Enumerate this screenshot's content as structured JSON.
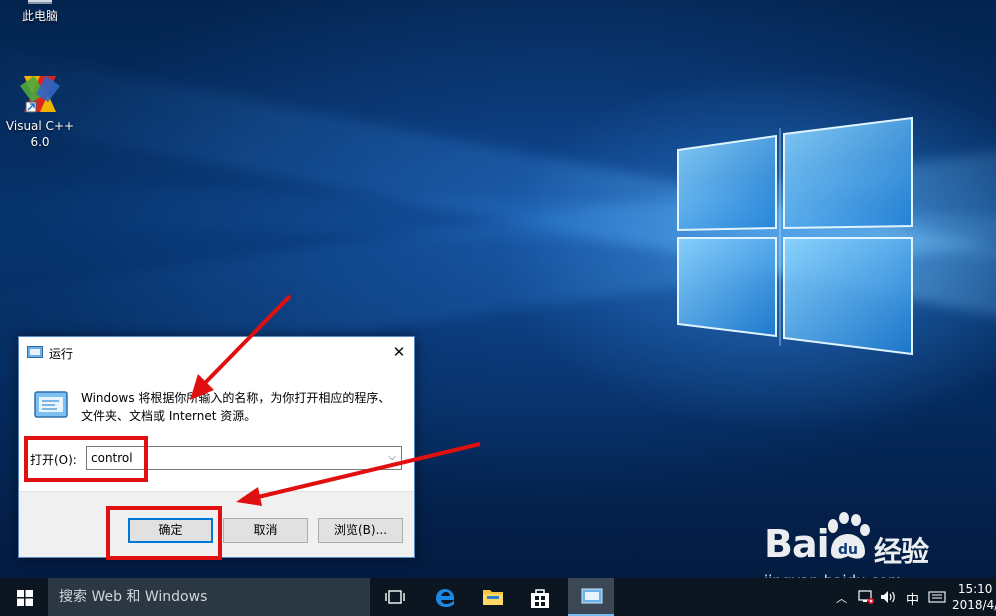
{
  "desktop": {
    "icons": [
      {
        "label": "此电脑",
        "icon": "this-pc-icon"
      },
      {
        "label": "Visual C++ 6.0",
        "icon": "visual-cpp-icon"
      }
    ]
  },
  "run_dialog": {
    "title": "运行",
    "close_glyph": "✕",
    "description": "Windows 将根据你所输入的名称，为你打开相应的程序、文件夹、文档或 Internet 资源。",
    "open_label": "打开(O):",
    "open_value": "control",
    "ok_label": "确定",
    "cancel_label": "取消",
    "browse_label": "浏览(B)..."
  },
  "watermark": {
    "brand": "Bai",
    "brand_suffix": "经验",
    "url": "jingyan.baidu.com"
  },
  "taskbar": {
    "search_placeholder": "搜索 Web 和 Windows",
    "ime_label": "中",
    "time": "15:10",
    "date": "2018/4/"
  },
  "colors": {
    "annotation_red": "#e01010",
    "taskbar": "#0c1621",
    "accent": "#0078d7"
  }
}
